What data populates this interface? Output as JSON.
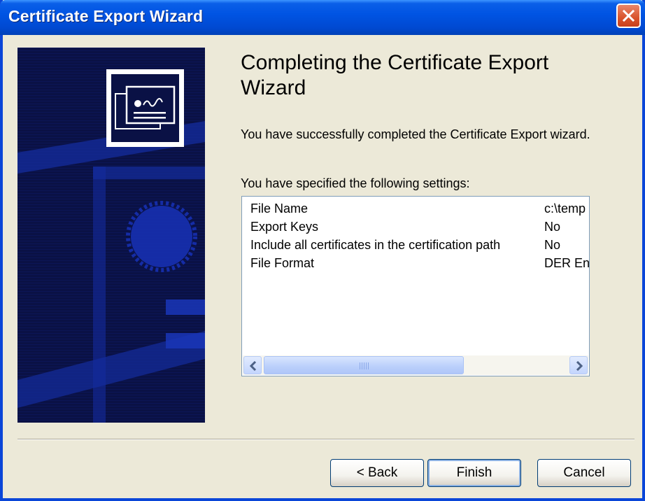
{
  "window": {
    "title": "Certificate Export Wizard"
  },
  "heading": "Completing the Certificate Export Wizard",
  "success_text": "You have successfully completed the Certificate Export wizard.",
  "settings_label": "You have specified the following settings:",
  "settings": [
    {
      "key": "File Name",
      "value": "c:\\temp"
    },
    {
      "key": "Export Keys",
      "value": "No"
    },
    {
      "key": "Include all certificates in the certification path",
      "value": "No"
    },
    {
      "key": "File Format",
      "value": "DER En"
    }
  ],
  "scrollbar": {
    "grip": "III"
  },
  "buttons": {
    "back": "< Back",
    "finish": "Finish",
    "cancel": "Cancel"
  },
  "icons": {
    "close": "close-icon",
    "certificate": "certificate-icon",
    "scroll_left": "chevron-left-icon",
    "scroll_right": "chevron-right-icon"
  },
  "colors": {
    "titlebar": "#0054E3",
    "banner": "#0A1040",
    "close_button": "#D9542B",
    "face": "#ECE9D8"
  }
}
